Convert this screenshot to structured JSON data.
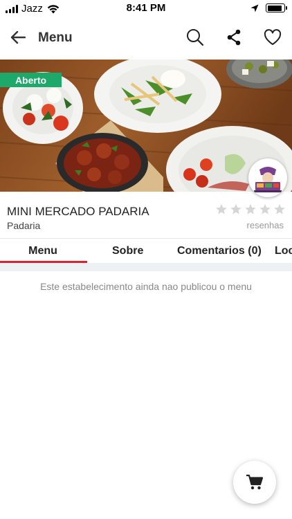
{
  "status_bar": {
    "carrier": "Jazz",
    "time": "8:41 PM",
    "battery_level": 0.9,
    "icons": [
      "signal-icon",
      "wifi-icon",
      "location-arrow-icon",
      "battery-icon"
    ]
  },
  "header": {
    "title": "Menu",
    "icons": [
      "back-arrow-icon",
      "search-icon",
      "share-icon",
      "heart-icon"
    ]
  },
  "store": {
    "status_badge": "Aberto",
    "name": "MINI MERCADO PADARIA",
    "category": "Padaria",
    "rating": 0,
    "rating_max": 5,
    "reviews_label": "resenhas"
  },
  "tabs": [
    {
      "label": "Menu",
      "active": true
    },
    {
      "label": "Sobre",
      "active": false
    },
    {
      "label": "Comentarios (0)",
      "active": false
    },
    {
      "label": "Loc",
      "active": false
    }
  ],
  "menu": {
    "empty_message": "Este estabelecimento ainda nao publicou o menu"
  },
  "fab": {
    "icon": "cart-icon"
  },
  "colors": {
    "accent": "#e0212b",
    "open_badge": "#1ea86a",
    "divider": "#eef0f3",
    "star_empty": "#d6d6d6"
  }
}
